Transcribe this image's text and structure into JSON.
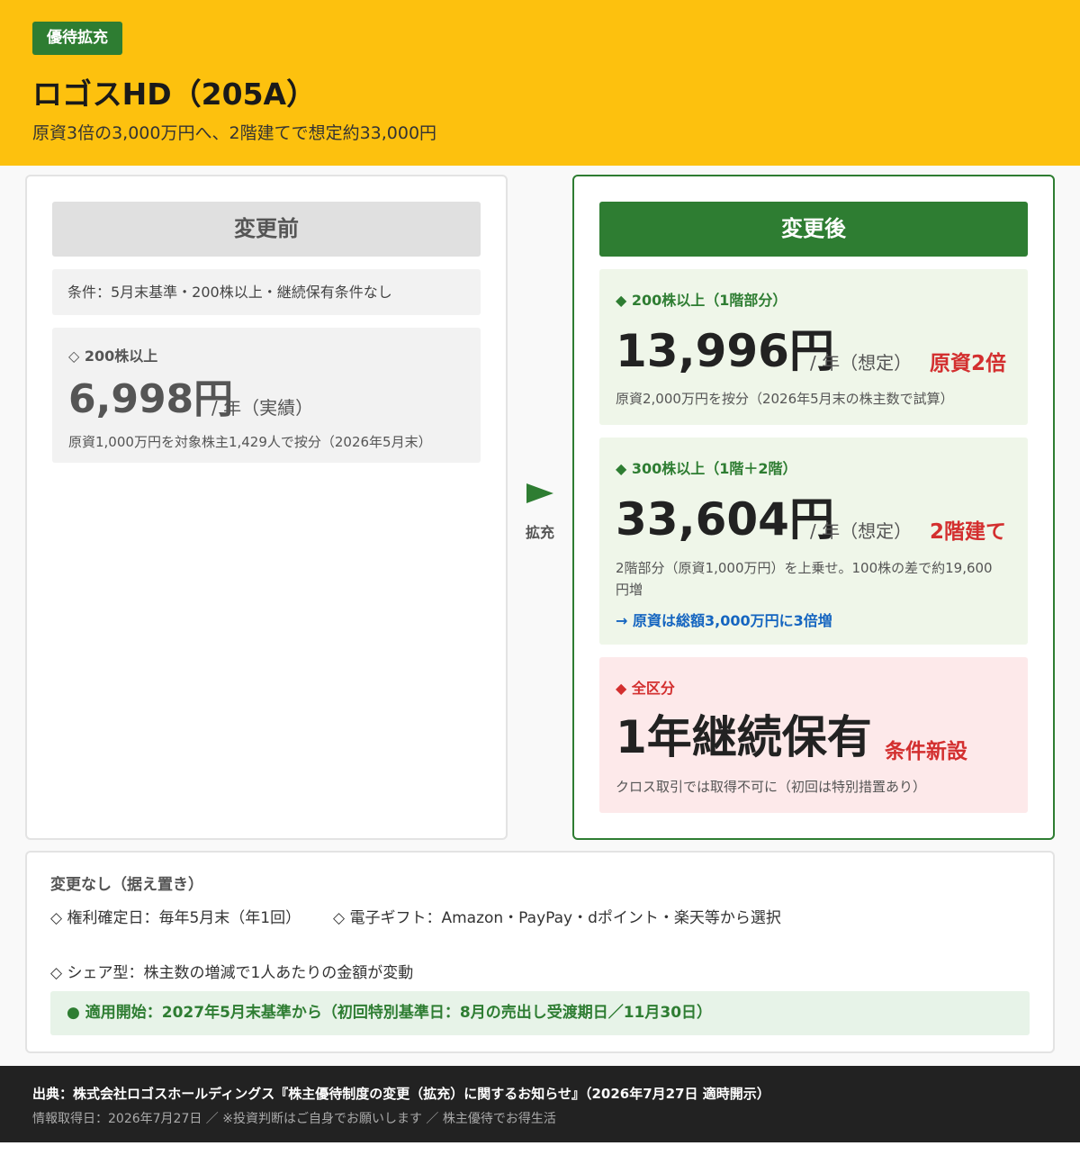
{
  "header": {
    "tag": "優待拡充",
    "title": "ロゴスHD（205A）",
    "subtitle": "原資3倍の3,000万円へ、2階建てで想定約33,000円"
  },
  "before": {
    "heading": "変更前",
    "condition": "条件：5月末基準・200株以上・継続保有条件なし",
    "tier": {
      "label": "◇ 200株以上",
      "amount": "6,998円",
      "unit": "/ 年（実績）",
      "note": "原資1,000万円を対象株主1,429人で按分（2026年5月末）"
    }
  },
  "arrow": {
    "label": "拡充"
  },
  "after": {
    "heading": "変更後",
    "tier1": {
      "label": "◆ 200株以上（1階部分）",
      "amount": "13,996円",
      "unit": "/ 年（想定）",
      "badge": "原資2倍",
      "note": "原資2,000万円を按分（2026年5月末の株主数で試算）"
    },
    "tier2": {
      "label": "◆ 300株以上（1階＋2階）",
      "amount": "33,604円",
      "unit": "/ 年（想定）",
      "badge": "2階建て",
      "note_line1": "2階部分（原資1,000万円）を上乗せ。100株の差で約19,600",
      "note_line2": "円増",
      "link": "→ 原資は総額3,000万円に3倍増"
    },
    "tier3": {
      "label": "◆ 全区分",
      "amount": "1年継続保有",
      "badge": "条件新設",
      "note": "クロス取引では取得不可に（初回は特別措置あり）"
    }
  },
  "nochange": {
    "title": "変更なし（据え置き）",
    "items": [
      "◇ 権利確定日：毎年5月末（年1回）",
      "◇ 電子ギフト：Amazon・PayPay・dポイント・楽天等から選択",
      "◇ シェア型：株主数の増減で1人あたりの金額が変動"
    ],
    "start": "● 適用開始：2027年5月末基準から（初回特別基準日：8月の売出し受渡期日／11月30日）"
  },
  "footer": {
    "source": "出典：株式会社ロゴスホールディングス『株主優待制度の変更（拡充）に関するお知らせ』（2026年7月27日 適時開示）",
    "info": "情報取得日：2026年7月27日 ／ ※投資判断はご自身でお願いします ／ 株主優待でお得生活"
  },
  "colors": {
    "header_bg": "#fdc10e",
    "accent_green": "#2e7d32",
    "accent_red": "#d32f2f",
    "link_blue": "#1565c0",
    "footer_bg": "#222222"
  }
}
